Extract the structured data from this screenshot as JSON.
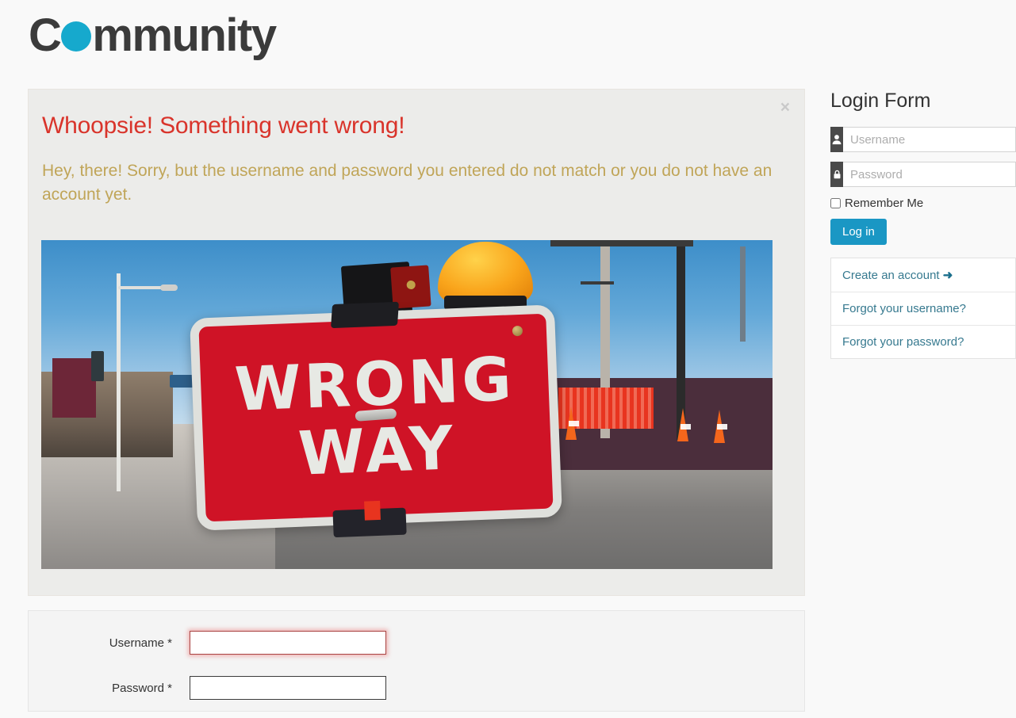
{
  "site": {
    "logo_text_before": "C",
    "logo_dot": "o",
    "logo_text_after": "mmunity",
    "accent_color": "#16a9cd"
  },
  "alert": {
    "close_label": "×",
    "title": "Whoopsie! Something went wrong!",
    "message": "Hey, there! Sorry, but the username and password you entered do not match or you do not have an account yet.",
    "title_color": "#d9342b",
    "message_color": "#c0a558",
    "background_color": "#ececea"
  },
  "photo": {
    "alt_name": "wrong-way-road-sign-photo",
    "sign_line_1": "WRONG",
    "sign_line_2": "WAY",
    "sign_color": "#cf1326",
    "sign_text_color": "#e7e9e4"
  },
  "login": {
    "title": "Login Form",
    "username_placeholder": "Username",
    "username_value": "",
    "password_placeholder": "Password",
    "password_value": "",
    "remember_label": "Remember Me",
    "remember_checked": false,
    "submit_label": "Log in",
    "submit_color": "#1a97c4",
    "links": [
      {
        "label": "Create an account",
        "icon": "arrow-right-icon",
        "glyph": "➜"
      },
      {
        "label": "Forgot your username?",
        "icon": "",
        "glyph": ""
      },
      {
        "label": "Forgot your password?",
        "icon": "",
        "glyph": ""
      }
    ],
    "link_color": "#36798f"
  },
  "bottom_form": {
    "rows": [
      {
        "label": "Username *",
        "value": "",
        "invalid": true
      },
      {
        "label": "Password *",
        "value": "",
        "invalid": false
      }
    ]
  }
}
